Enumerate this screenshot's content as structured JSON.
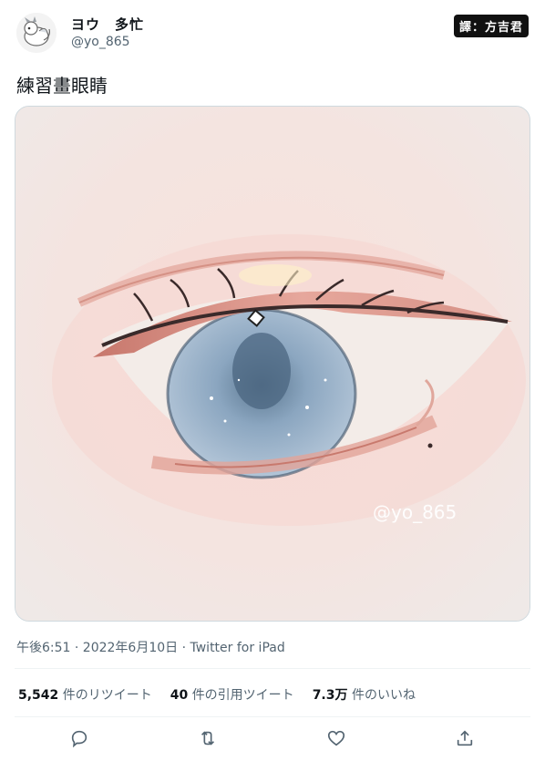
{
  "author": {
    "display_name": "ヨウ　多忙",
    "handle": "@yo_865",
    "avatar_icon": "dragon-avatar-icon"
  },
  "translator_badge": "譯：方吉君",
  "tweet": {
    "text": "練習畫眼睛",
    "image_watermark": "@yo_865",
    "timestamp": "午後6:51 · 2022年6月10日 · Twitter for iPad"
  },
  "stats": {
    "retweets_value": "5,542",
    "retweets_label": "件のリツイート",
    "quotes_value": "40",
    "quotes_label": "件の引用ツイート",
    "likes_value": "7.3万",
    "likes_label": "件のいいね"
  },
  "actions": {
    "reply_icon": "reply-icon",
    "retweet_icon": "retweet-icon",
    "like_icon": "heart-icon",
    "share_icon": "share-icon"
  },
  "colors": {
    "text_primary": "#0f1419",
    "text_secondary": "#536471",
    "border": "#cfd9de",
    "iris": "#8aa4bf",
    "skin": "#f4e9e6"
  }
}
